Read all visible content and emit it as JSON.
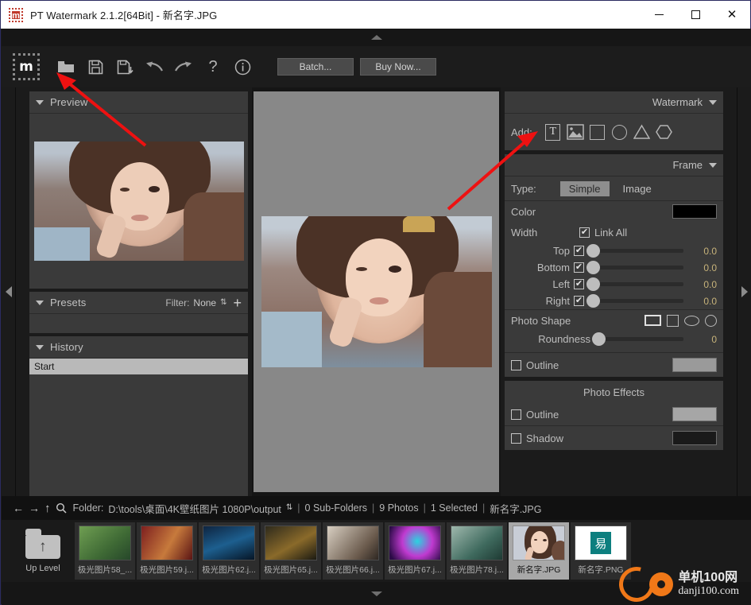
{
  "window": {
    "title": "PT Watermark 2.1.2[64Bit] - 新名字.JPG",
    "app_icon": "m",
    "minimize_label": "minimize",
    "maximize_label": "maximize",
    "close_label": "✕"
  },
  "toolbar": {
    "logo_text": "m",
    "open_icon": "folder-open",
    "save_icon": "save",
    "save_as_icon": "save-as",
    "undo_icon": "undo",
    "redo_icon": "redo",
    "help_icon": "?",
    "info_icon": "i",
    "batch_label": "Batch...",
    "buy_label": "Buy Now..."
  },
  "left": {
    "preview": {
      "title": "Preview"
    },
    "presets": {
      "title": "Presets",
      "filter_label": "Filter:",
      "filter_value": "None",
      "add_label": "+"
    },
    "history": {
      "title": "History",
      "items": [
        {
          "label": "Start",
          "selected": true
        }
      ]
    }
  },
  "right": {
    "watermark": {
      "title": "Watermark",
      "add_label": "Add:",
      "shapes": [
        {
          "name": "text",
          "glyph": "T"
        },
        {
          "name": "image",
          "glyph": ""
        },
        {
          "name": "square",
          "glyph": ""
        },
        {
          "name": "circle",
          "glyph": ""
        },
        {
          "name": "triangle",
          "glyph": ""
        },
        {
          "name": "hexagon",
          "glyph": ""
        }
      ]
    },
    "frame": {
      "title": "Frame",
      "type_label": "Type:",
      "type_options": [
        "Simple",
        "Image"
      ],
      "type_selected": "Simple",
      "color_label": "Color",
      "color_value": "#000000",
      "width_label": "Width",
      "link_all_label": "Link All",
      "link_all_checked": true,
      "sliders": [
        {
          "label": "Top",
          "checked": true,
          "value": "0.0",
          "pos": 0
        },
        {
          "label": "Bottom",
          "checked": true,
          "value": "0.0",
          "pos": 0
        },
        {
          "label": "Left",
          "checked": true,
          "value": "0.0",
          "pos": 0
        },
        {
          "label": "Right",
          "checked": true,
          "value": "0.0",
          "pos": 0
        }
      ],
      "photo_shape_label": "Photo Shape",
      "photo_shapes": [
        "rectangle",
        "square",
        "ellipse",
        "circle"
      ],
      "photo_shape_selected": "rectangle",
      "roundness_label": "Roundness",
      "roundness_value": "0",
      "frame_outline_label": "Outline",
      "frame_outline_checked": false,
      "frame_outline_color": "#9a9a9a"
    },
    "photo_effects": {
      "title": "Photo Effects",
      "outline_label": "Outline",
      "outline_checked": false,
      "outline_color": "#a6a6a6",
      "shadow_label": "Shadow",
      "shadow_checked": false,
      "shadow_color": "#1a1a1a"
    }
  },
  "status": {
    "back_icon": "←",
    "forward_icon": "→",
    "up_icon": "↑",
    "search_icon": "search",
    "folder_label": "Folder:",
    "folder_path": "D:\\tools\\桌面\\4K壁纸图片 1080P\\output",
    "updown_icon": "⇕",
    "sep": "|",
    "subfolders": "0 Sub-Folders",
    "photos": "9 Photos",
    "selected": "1 Selected",
    "current_file": "新名字.JPG"
  },
  "filmstrip": {
    "up_level_label": "Up Level",
    "items": [
      {
        "label": "极光图片58_...",
        "selected": false,
        "c1": "#6f9e52",
        "c2": "#3f6a35"
      },
      {
        "label": "极光图片59.j...",
        "selected": false,
        "c1": "#7d1f1f",
        "c2": "#c77a3c"
      },
      {
        "label": "极光图片62.j...",
        "selected": false,
        "c1": "#0e2440",
        "c2": "#1d5f8f"
      },
      {
        "label": "极光图片65.j...",
        "selected": false,
        "c1": "#2e2a1c",
        "c2": "#8a6a2a"
      },
      {
        "label": "极光图片66.j...",
        "selected": false,
        "c1": "#d8cfc2",
        "c2": "#6a5a4c"
      },
      {
        "label": "极光图片67.j...",
        "selected": false,
        "c1": "#2b0b46",
        "c2": "#c03ad0"
      },
      {
        "label": "极光图片78.j...",
        "selected": false,
        "c1": "#9fb8ad",
        "c2": "#3f6a5e"
      },
      {
        "label": "新名字.JPG",
        "selected": true,
        "c1": "#c8cdd6",
        "c2": "#8a6f64"
      },
      {
        "label": "新名字.PNG",
        "selected": false,
        "c1": "#ffffff",
        "c2": "#0d7f7f"
      }
    ]
  },
  "branding": {
    "line1": "单机100网",
    "line2": "danji100.com"
  }
}
